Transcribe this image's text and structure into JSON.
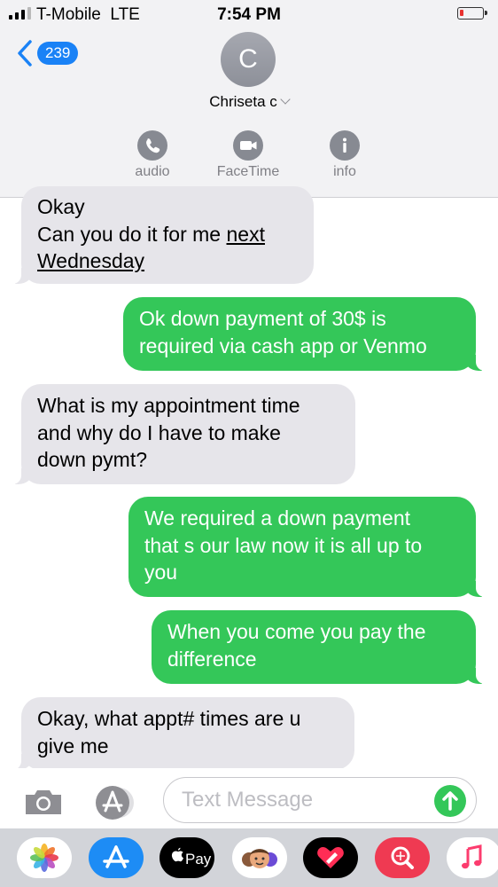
{
  "status_bar": {
    "carrier": "T-Mobile",
    "network": "LTE",
    "time": "7:54 PM"
  },
  "header": {
    "back_count": "239",
    "avatar_initial": "C",
    "contact_name": "Chriseta c",
    "actions": [
      {
        "label": "audio",
        "icon": "phone-icon"
      },
      {
        "label": "FaceTime",
        "icon": "video-camera-icon"
      },
      {
        "label": "info",
        "icon": "info-icon"
      }
    ]
  },
  "messages": [
    {
      "direction": "incoming",
      "lines": [
        "Okay",
        "Can you do it for me",
        "next",
        "Wednesday"
      ]
    },
    {
      "direction": "outgoing",
      "lines": [
        "Ok down payment of 30$ is",
        "required via cash app or Venmo"
      ]
    },
    {
      "direction": "incoming",
      "lines": [
        "What is my appointment time",
        "and why do I have to make",
        "down pymt?"
      ]
    },
    {
      "direction": "outgoing",
      "lines": [
        "We required a down payment",
        "that s our law now it is all up to",
        "you"
      ]
    },
    {
      "direction": "outgoing",
      "lines": [
        "When you come you pay the",
        "difference"
      ]
    },
    {
      "direction": "incoming",
      "lines": [
        "Okay, what appt# times are u",
        "give me"
      ]
    }
  ],
  "compose": {
    "placeholder": "Text Message"
  },
  "app_drawer": {
    "apps": [
      {
        "name": "Photos",
        "icon": "photos-icon"
      },
      {
        "name": "App Store",
        "icon": "app-store-icon"
      },
      {
        "name": "Apple Pay",
        "icon": "apple-pay-icon",
        "text": "Pay"
      },
      {
        "name": "Memoji",
        "icon": "memoji-icon"
      },
      {
        "name": "Digital Touch",
        "icon": "digital-touch-icon"
      },
      {
        "name": "Search Images",
        "icon": "image-search-icon"
      },
      {
        "name": "Music",
        "icon": "music-icon"
      }
    ]
  },
  "colors": {
    "outgoing_bubble": "#34c759",
    "incoming_bubble": "#e6e5ea",
    "accent": "#1a82f6"
  }
}
